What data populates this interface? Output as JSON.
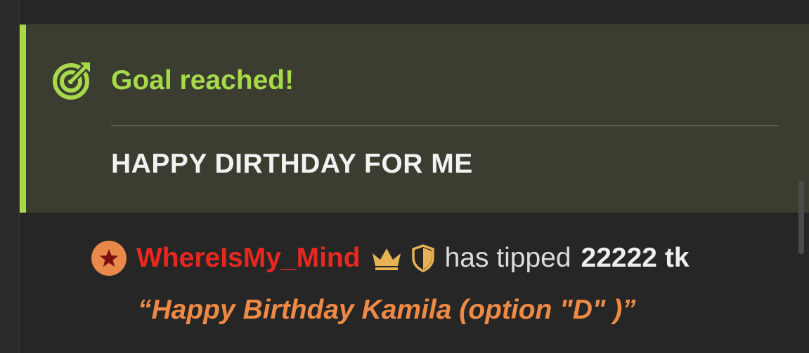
{
  "goal": {
    "title": "Goal reached!",
    "message": "HAPPY DIRTHDAY FOR ME",
    "icon": "target-arrow-icon",
    "accent_color": "#a7d94a"
  },
  "tip": {
    "username": "WhereIsMy_Mind",
    "username_color": "#e8281f",
    "badges": [
      "star-icon",
      "crown-icon",
      "shield-icon"
    ],
    "action_text": "has tipped",
    "amount": "22222 tk",
    "message": "“Happy Birthday Kamila (option \"D\" )”",
    "message_color": "#ef8a45"
  }
}
